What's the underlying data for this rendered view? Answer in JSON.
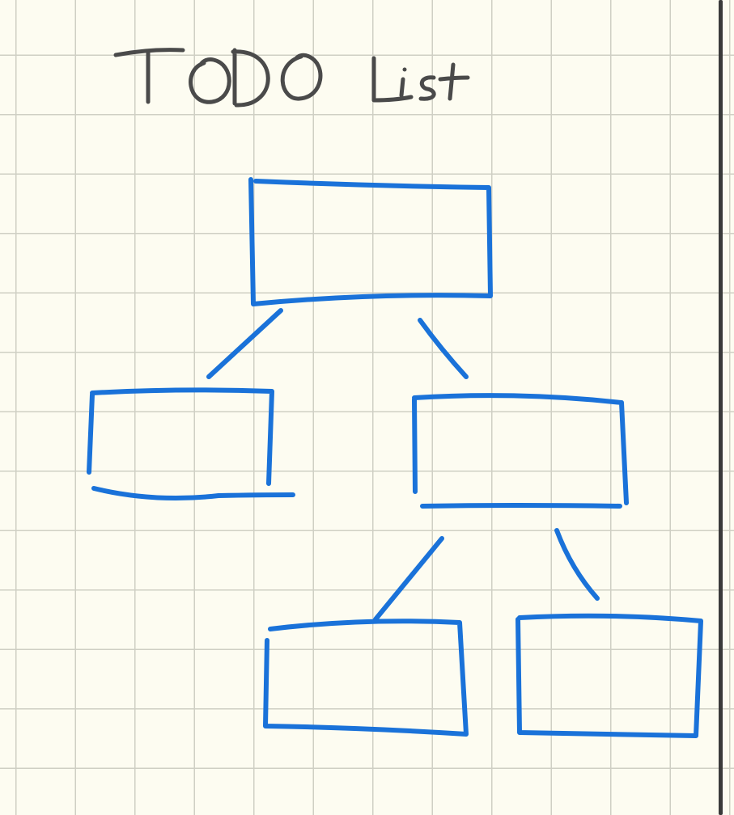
{
  "title": "TODO List",
  "colors": {
    "paper": "#fdfcf1",
    "grid": "#cfcfc4",
    "ink": "#4a4a4a",
    "boxes": "#1a72d9",
    "page_edge": "#3a3a3a"
  },
  "diagram": {
    "type": "tree",
    "nodes": [
      {
        "id": "root",
        "label": ""
      },
      {
        "id": "left-child",
        "label": ""
      },
      {
        "id": "right-child",
        "label": ""
      },
      {
        "id": "grandchild-left",
        "label": ""
      },
      {
        "id": "grandchild-right",
        "label": ""
      }
    ],
    "edges": [
      {
        "from": "root",
        "to": "left-child"
      },
      {
        "from": "root",
        "to": "right-child"
      },
      {
        "from": "right-child",
        "to": "grandchild-left"
      },
      {
        "from": "right-child",
        "to": "grandchild-right"
      }
    ]
  }
}
